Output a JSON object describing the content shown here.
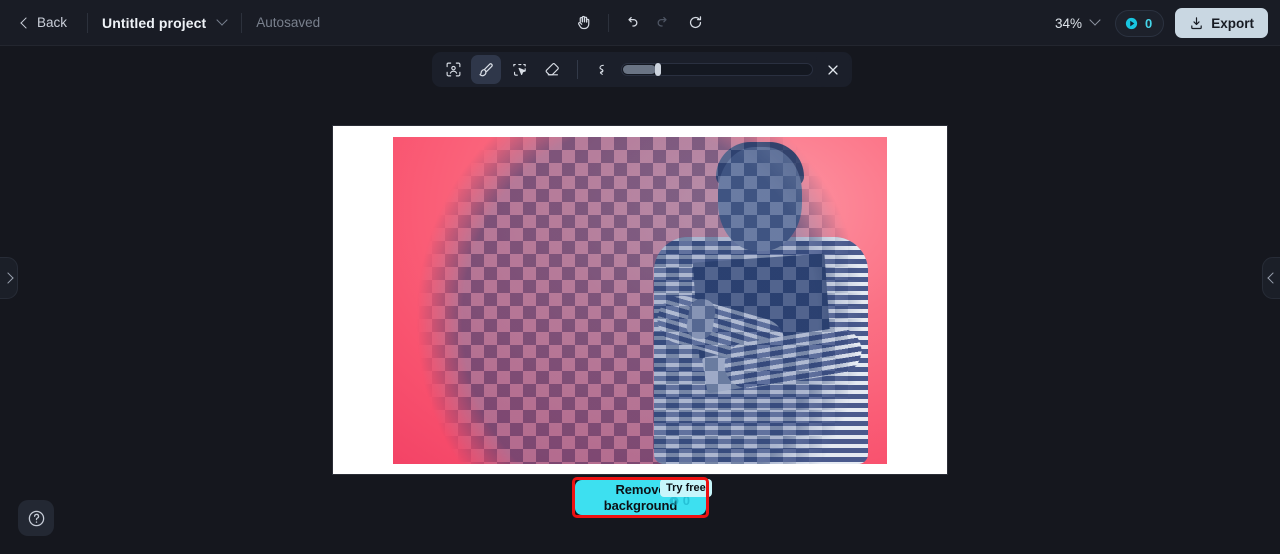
{
  "topbar": {
    "back_label": "Back",
    "project_name": "Untitled project",
    "autosaved_label": "Autosaved",
    "pan_icon": "hand-icon",
    "undo_icon": "undo-icon",
    "redo_icon": "redo-icon",
    "reset_icon": "reset-icon",
    "zoom_level": "34%",
    "credits_count": "0",
    "credits_icon": "credit-token-icon",
    "export_label": "Export",
    "export_icon": "download-icon"
  },
  "toolpanel": {
    "tools": [
      {
        "name": "select-subject-icon",
        "label": "Select subject",
        "active": false
      },
      {
        "name": "brush-icon",
        "label": "Brush",
        "active": true
      },
      {
        "name": "magic-select-icon",
        "label": "Magic select",
        "active": false
      },
      {
        "name": "eraser-icon",
        "label": "Eraser",
        "active": false
      }
    ],
    "brush_size_small_icon": "brush-size-small-icon",
    "brush_size_large_icon": "brush-size-large-icon",
    "brush_size_value": "17",
    "close_icon": "close-icon"
  },
  "canvas": {
    "background_color": "#15171e",
    "page_color": "#ffffff",
    "image_description": "Person holding a laptop on a pink gradient background",
    "mask_overlay": "checkerboard-selection-mask",
    "left_handle_icon": "chevron-right-icon",
    "right_handle_icon": "chevron-left-icon"
  },
  "help": {
    "icon": "help-circle-icon",
    "label": "Help"
  },
  "cta": {
    "button_label_line1": "Remove",
    "button_label_line2": "background",
    "badge_label": "Try free",
    "ghost_credits": "0",
    "button_color": "#3de0f0",
    "badge_color": "#c7f6fb",
    "annotation_color": "#ee1111"
  }
}
